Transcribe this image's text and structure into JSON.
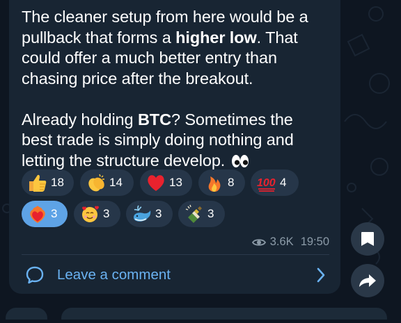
{
  "message": {
    "para1_pre": "The cleaner setup from here would be a pullback that forms a ",
    "para1_bold": "higher low",
    "para1_post": ". That could offer a much better entry than chasing price after the breakout.",
    "para2_pre": "Already holding ",
    "para2_bold": "BTC",
    "para2_post": "? Sometimes the best trade is simply doing nothing and letting the structure develop. "
  },
  "reactions": [
    {
      "emoji": "thumbs-up",
      "count": "18"
    },
    {
      "emoji": "clapping-hands",
      "count": "14"
    },
    {
      "emoji": "red-heart",
      "count": "13"
    },
    {
      "emoji": "fire",
      "count": "8"
    },
    {
      "emoji": "hundred-points",
      "count": "4"
    },
    {
      "emoji": "heart-on-fire",
      "count": "3",
      "selected": true
    },
    {
      "emoji": "smiling-face-with-hearts",
      "count": "3"
    },
    {
      "emoji": "spouting-whale",
      "count": "3"
    },
    {
      "emoji": "champagne-bottle",
      "count": "3"
    }
  ],
  "views": "3.6K",
  "time": "19:50",
  "comment_label": "Leave a comment",
  "colors": {
    "accent": "#6ab2f2",
    "bubble": "#182533",
    "background": "#0e1621",
    "selected_reaction": "#5ea3e6"
  }
}
